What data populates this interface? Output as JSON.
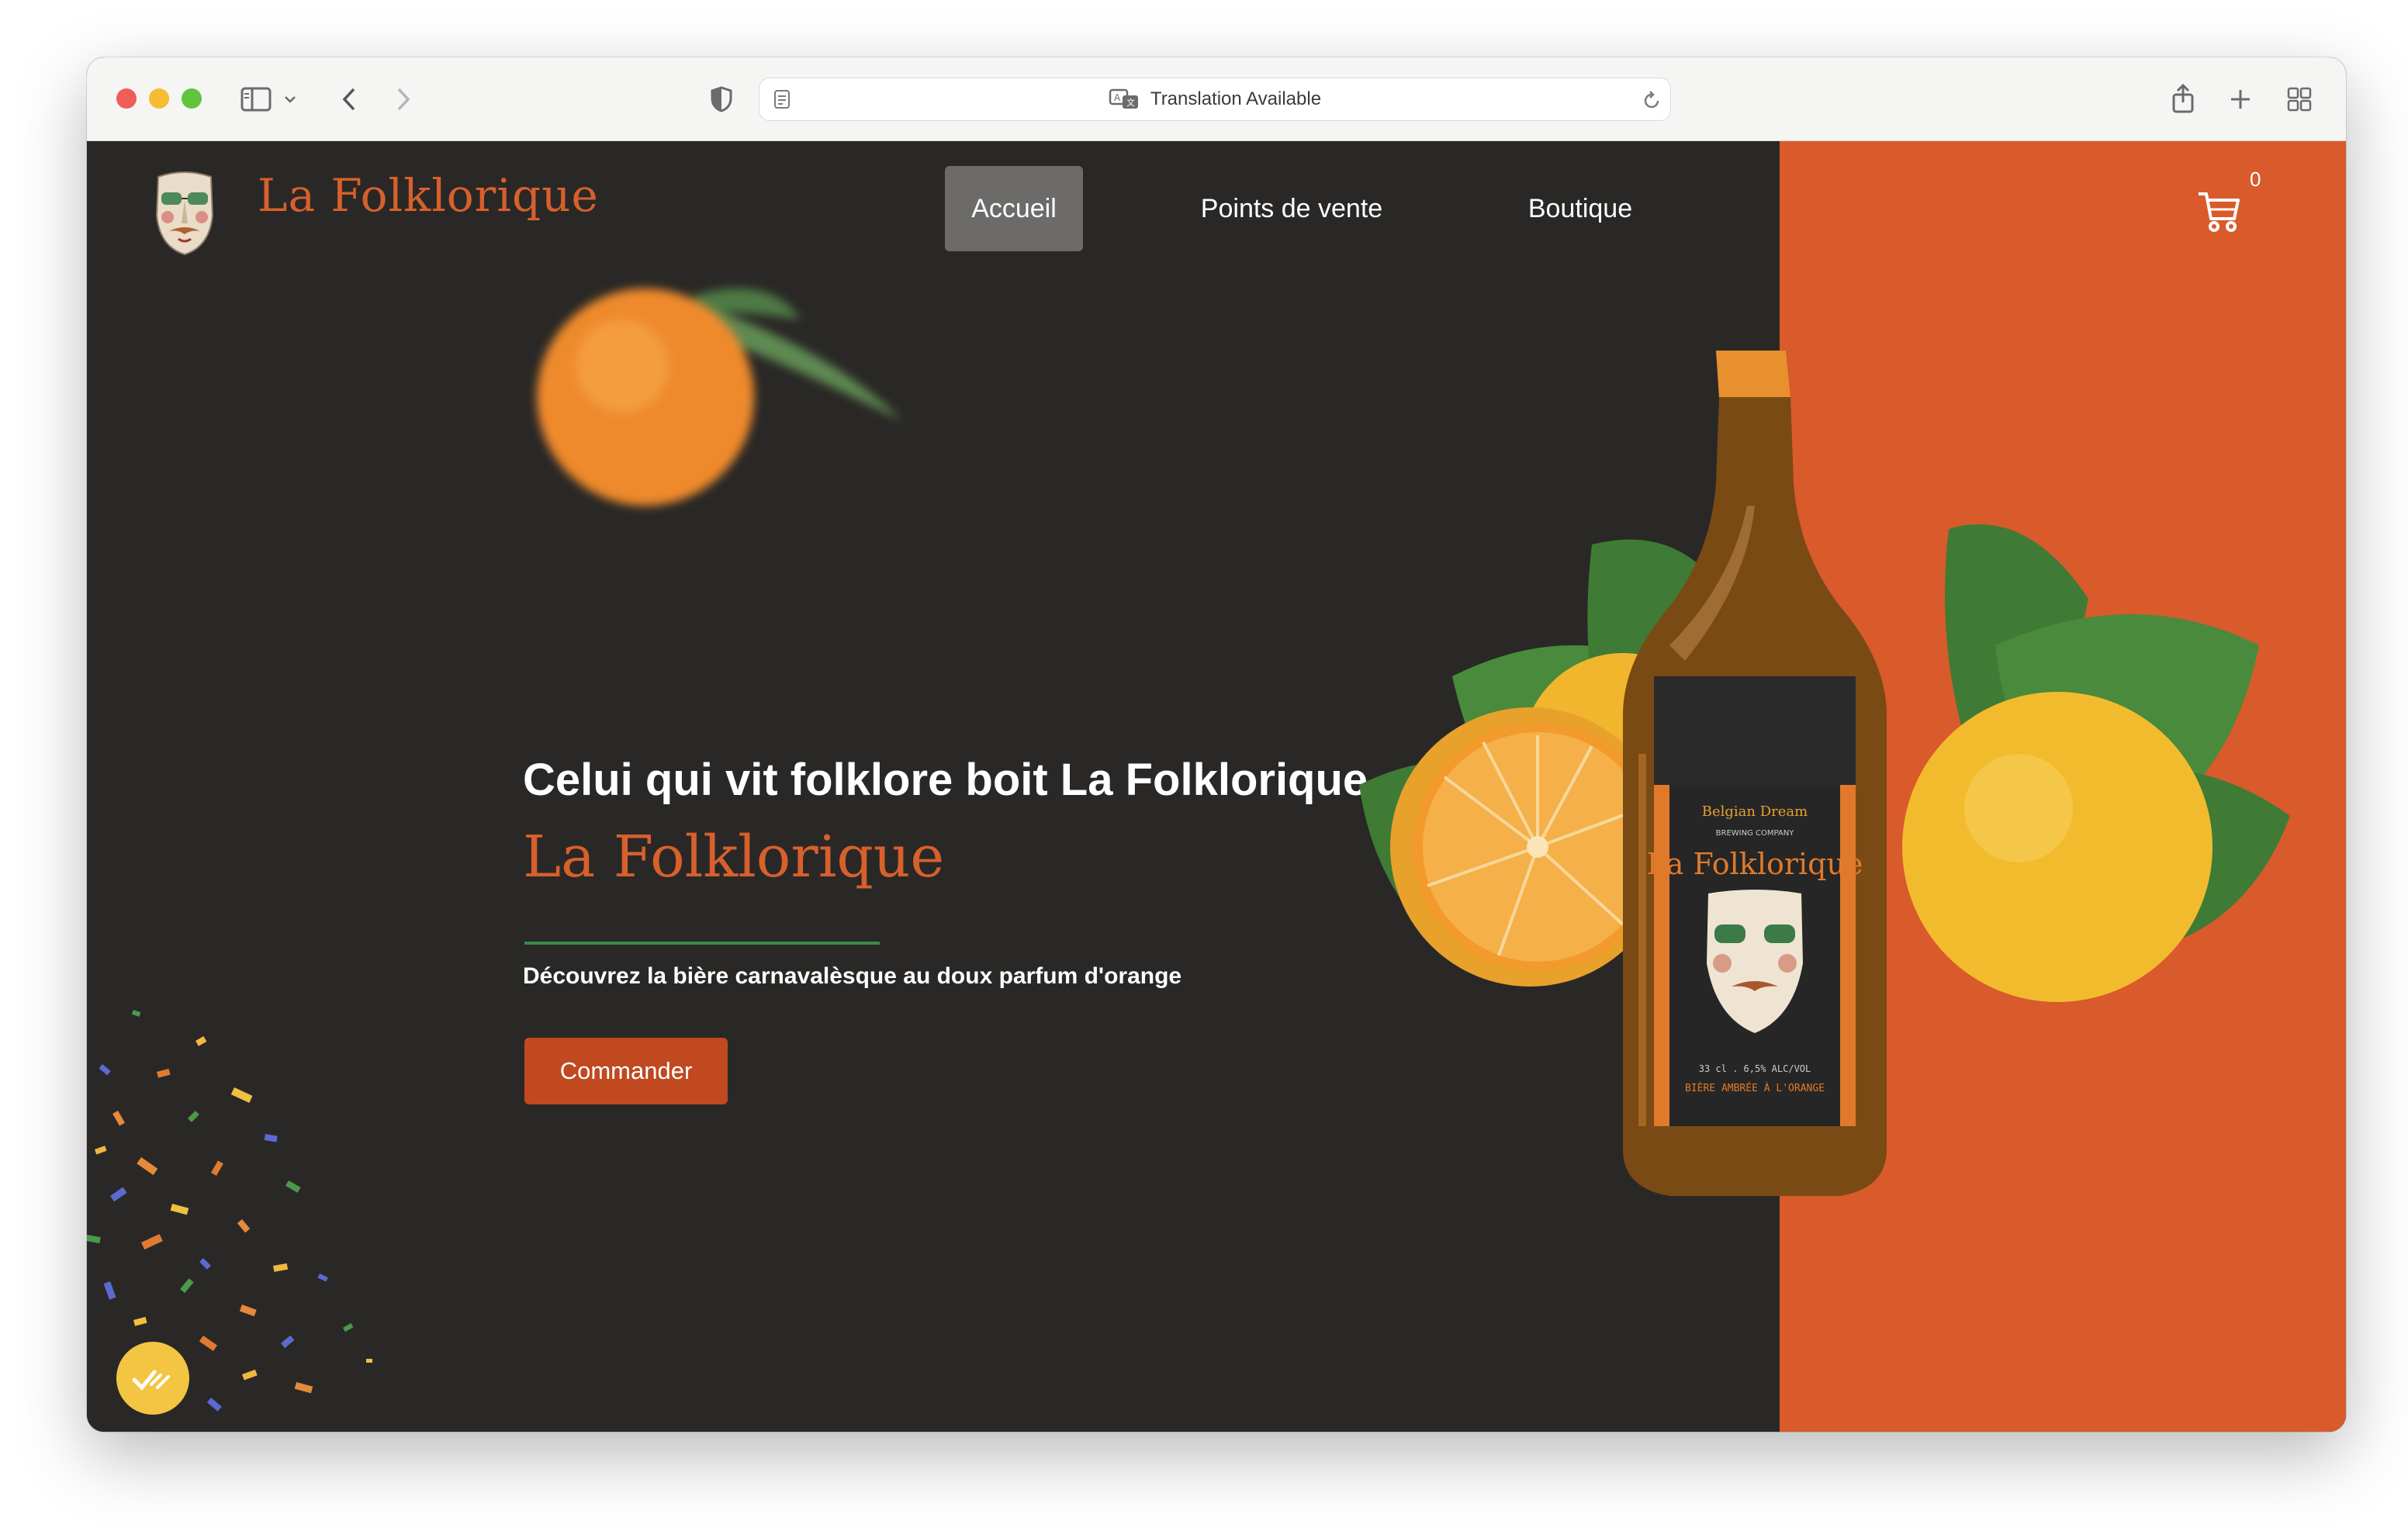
{
  "browser": {
    "url_text": "Translation Available"
  },
  "site": {
    "brand": "La Folklorique",
    "nav": [
      {
        "label": "Accueil",
        "active": true
      },
      {
        "label": "Points de vente",
        "active": false
      },
      {
        "label": "Boutique",
        "active": false
      }
    ],
    "cart_count": "0"
  },
  "hero": {
    "headline": "Celui qui vit folklore boit La Folklorique",
    "brand": "La Folklorique",
    "subtitle": "Découvrez la bière carnavalèsque au doux parfum d'orange",
    "cta": "Commander"
  },
  "product_label": {
    "maker": "Belgian Dream",
    "maker_sub": "BREWING COMPANY",
    "name": "La Folklorique",
    "volume": "33 cl . 6,5% ALC/VOL",
    "type": "BIÈRE AMBRÉE À L'ORANGE"
  },
  "colors": {
    "page_bg": "#2a2826",
    "accent_orange": "#d95a2b",
    "brand_orange": "#d7602c",
    "cta_bg": "#c0491f",
    "rule_green": "#3a8a4a"
  },
  "icons": [
    "sidebar-icon",
    "chevron-down-icon",
    "back-icon",
    "forward-icon",
    "shield-icon",
    "reader-icon",
    "translate-icon",
    "reload-icon",
    "share-icon",
    "new-tab-icon",
    "tab-overview-icon",
    "cart-icon",
    "checklist-badge-icon"
  ]
}
